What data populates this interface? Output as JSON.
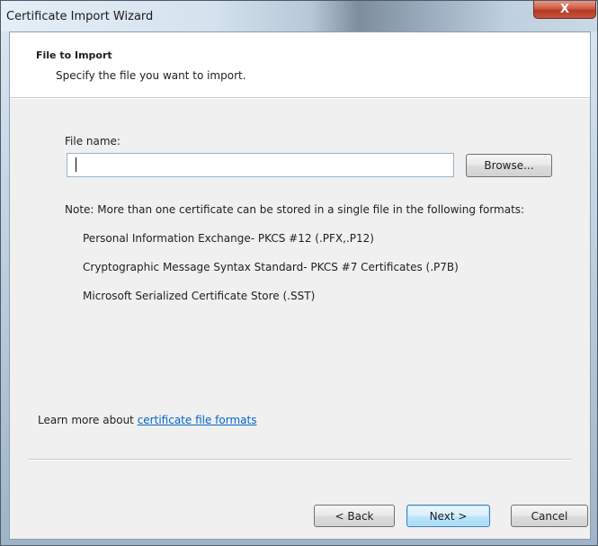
{
  "window": {
    "title": "Certificate Import Wizard",
    "close_label": "X"
  },
  "header": {
    "title": "File to Import",
    "subtitle": "Specify the file you want to import."
  },
  "file": {
    "label": "File name:",
    "value": "",
    "browse_label": "Browse..."
  },
  "note": {
    "text": "Note:  More than one certificate can be stored in a single file in the following formats:",
    "formats": [
      "Personal Information Exchange- PKCS #12 (.PFX,.P12)",
      "Cryptographic Message Syntax Standard- PKCS #7 Certificates (.P7B)",
      "Microsoft Serialized Certificate Store (.SST)"
    ]
  },
  "learn": {
    "prefix": "Learn more about ",
    "link": "certificate file formats"
  },
  "buttons": {
    "back": "< Back",
    "next": "Next >",
    "cancel": "Cancel"
  },
  "colors": {
    "link": "#0066cc",
    "close_button": "#c7533b",
    "default_button_border": "#3c7fb1"
  }
}
